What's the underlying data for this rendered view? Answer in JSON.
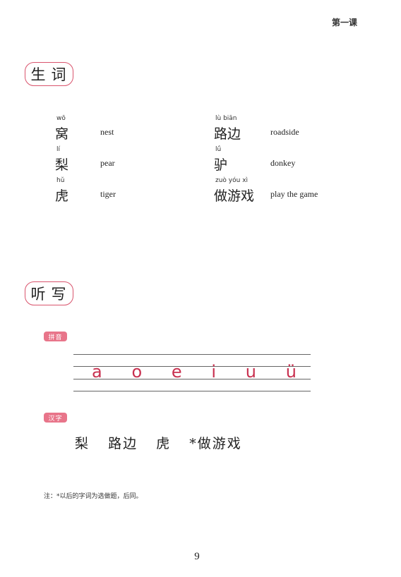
{
  "header": {
    "lesson": "第一课"
  },
  "vocab_section": {
    "title": "生词"
  },
  "vocab_left": [
    {
      "pinyin": "wō",
      "hanzi": "窝",
      "english": "nest"
    },
    {
      "pinyin": "lí",
      "hanzi": "梨",
      "english": "pear"
    },
    {
      "pinyin": "hǔ",
      "hanzi": "虎",
      "english": "tiger"
    }
  ],
  "vocab_right": [
    {
      "pinyin": "lù biān",
      "hanzi": "路边",
      "english": "roadside"
    },
    {
      "pinyin": "lǘ",
      "hanzi": "驴",
      "english": "donkey"
    },
    {
      "pinyin": "zuò yóu xì",
      "hanzi": "做游戏",
      "english": "play the game"
    }
  ],
  "dictation_section": {
    "title": "听写"
  },
  "pinyin_tag": "拼音",
  "pinyin_letters": [
    "a",
    "o",
    "e",
    "i",
    "u",
    "ü"
  ],
  "hanzi_tag": "汉字",
  "hanzi_words": [
    "梨",
    "路边",
    "虎",
    "*做游戏"
  ],
  "note": "注：*以后的字词为选做题，后同。",
  "page_number": "9"
}
